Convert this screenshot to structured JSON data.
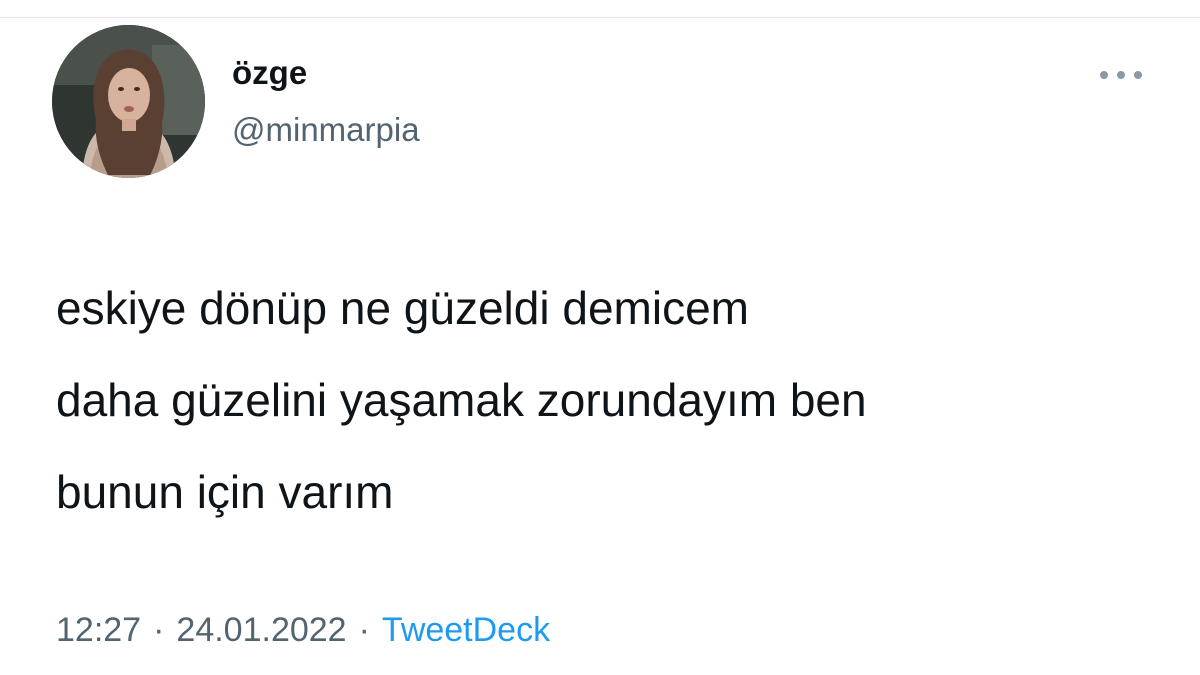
{
  "tweet": {
    "author": {
      "display_name": "özge",
      "handle": "@minmarpia",
      "avatar_icon": "profile-photo"
    },
    "more_icon": "ellipsis-icon",
    "text_lines": [
      "eskiye dönüp ne güzeldi demicem",
      "daha güzelini yaşamak zorundayım ben",
      "bunun için varım"
    ],
    "time": "12:27",
    "separator": "·",
    "date": "24.01.2022",
    "source": "TweetDeck"
  },
  "colors": {
    "text_primary": "#0f1419",
    "text_secondary": "#536471",
    "link": "#1d9bf0"
  }
}
